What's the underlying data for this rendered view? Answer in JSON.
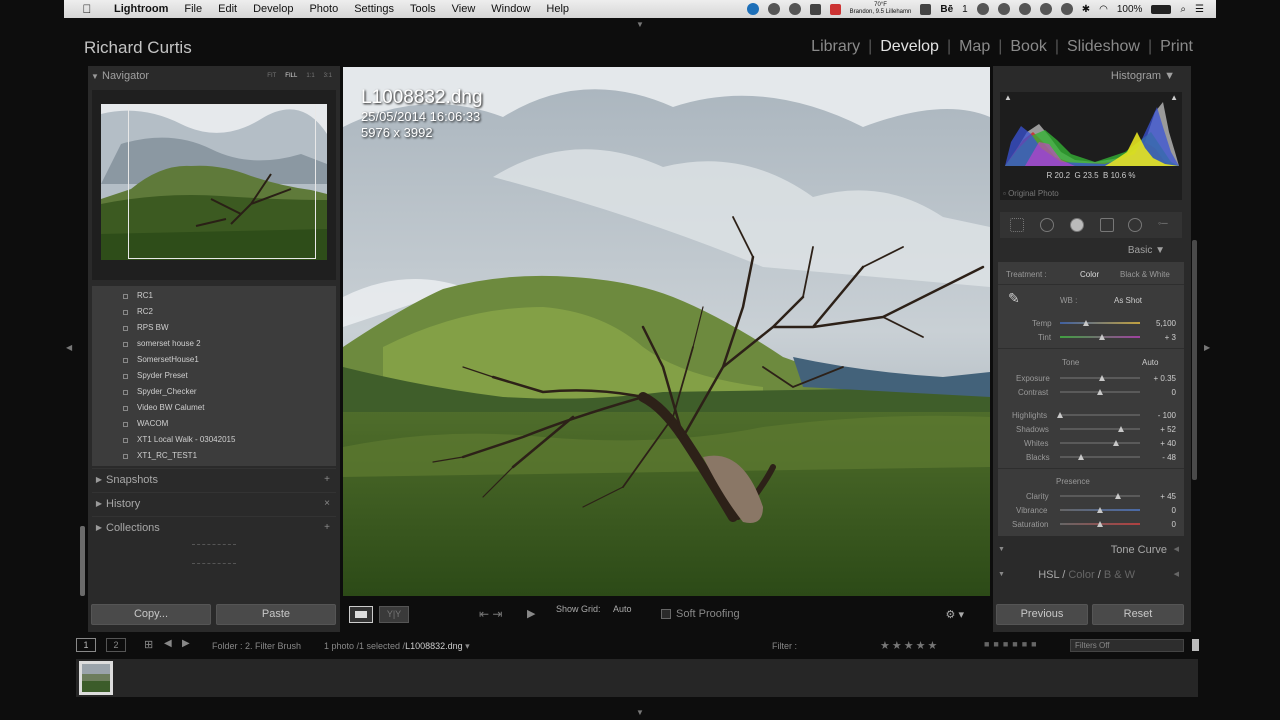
{
  "menubar": {
    "apple": "",
    "items": [
      "Lightroom",
      "File",
      "Edit",
      "Develop",
      "Photo",
      "Settings",
      "Tools",
      "View",
      "Window",
      "Help"
    ],
    "weather_temp": "70°F",
    "weather_loc": "Brandon, 9.5 Lillehamn",
    "status_b": "Bē",
    "status_num": "1",
    "battery": "100%"
  },
  "identity_plate": "Richard Curtis",
  "modules": [
    {
      "label": "Library",
      "active": false
    },
    {
      "label": "Develop",
      "active": true
    },
    {
      "label": "Map",
      "active": false
    },
    {
      "label": "Book",
      "active": false
    },
    {
      "label": "Slideshow",
      "active": false
    },
    {
      "label": "Print",
      "active": false
    }
  ],
  "navigator": {
    "title": "Navigator",
    "zoom": [
      "FIT",
      "FILL",
      "1:1",
      "3:1"
    ]
  },
  "presets": [
    "RC1",
    "RC2",
    "RPS BW",
    "somerset house 2",
    "SomersetHouse1",
    "Spyder Preset",
    "Spyder_Checker",
    "Video BW Calumet",
    "WACOM",
    "XT1 Local Walk - 03042015",
    "XT1_RC_TEST1"
  ],
  "left_sections": [
    "Snapshots",
    "History",
    "Collections"
  ],
  "left_buttons": {
    "copy": "Copy...",
    "paste": "Paste"
  },
  "photo": {
    "filename": "L1008832.dng",
    "datetime": "25/05/2014 16:06:33",
    "dimensions": "5976 x 3992"
  },
  "toolbar": {
    "show_grid": "Show Grid:",
    "auto": "Auto",
    "soft_proofing": "Soft Proofing"
  },
  "histogram": {
    "title": "Histogram",
    "r_label": "R",
    "r_value": "20.2",
    "g_label": "G",
    "g_value": "23.5",
    "b_label": "B",
    "b_value": "10.6 %",
    "original": "Original Photo"
  },
  "basic": {
    "title": "Basic",
    "treatment_label": "Treatment :",
    "treatment_color": "Color",
    "treatment_bw": "Black & White",
    "wb_label": "WB :",
    "wb_value": "As Shot",
    "tone_label": "Tone",
    "tone_auto": "Auto",
    "presence_label": "Presence",
    "sliders_wb": [
      {
        "label": "Temp",
        "value": "5,100",
        "pos": 0.33
      },
      {
        "label": "Tint",
        "value": "+ 3",
        "pos": 0.52
      }
    ],
    "sliders_tone": [
      {
        "label": "Exposure",
        "value": "+ 0.35",
        "pos": 0.53
      },
      {
        "label": "Contrast",
        "value": "0",
        "pos": 0.5
      }
    ],
    "sliders_tone2": [
      {
        "label": "Highlights",
        "value": "- 100",
        "pos": 0.0
      },
      {
        "label": "Shadows",
        "value": "+ 52",
        "pos": 0.76
      },
      {
        "label": "Whites",
        "value": "+ 40",
        "pos": 0.7
      },
      {
        "label": "Blacks",
        "value": "- 48",
        "pos": 0.26
      }
    ],
    "sliders_presence": [
      {
        "label": "Clarity",
        "value": "+ 45",
        "pos": 0.72
      },
      {
        "label": "Vibrance",
        "value": "0",
        "pos": 0.5
      },
      {
        "label": "Saturation",
        "value": "0",
        "pos": 0.5
      }
    ]
  },
  "right_sections": {
    "tone_curve": "Tone Curve",
    "hsl": "HSL",
    "color": "Color",
    "bw": "B & W"
  },
  "right_buttons": {
    "previous": "Previous",
    "reset": "Reset"
  },
  "filmstrip": {
    "screen1": "1",
    "screen2": "2",
    "folder": "Folder : 2. Filter Brush",
    "count": "1 photo /1 selected /",
    "selected": "L1008832.dng",
    "filter": "Filter :",
    "stars": "★★★★★",
    "filters_off": "Filters Off"
  }
}
